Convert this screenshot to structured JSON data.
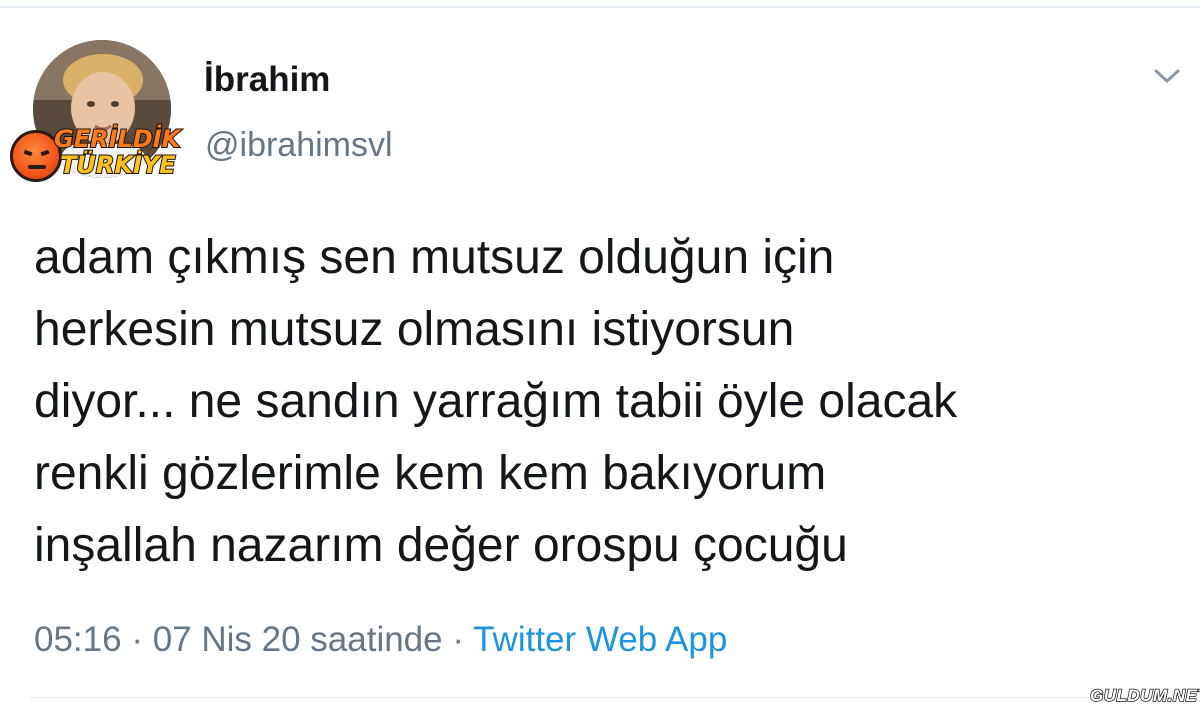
{
  "user": {
    "display_name": "İbrahim",
    "handle": "@ibrahimsvl"
  },
  "badge": {
    "line1": "GERİLDİK",
    "line2": "TÜRKİYE"
  },
  "tweet": {
    "lines": [
      "adam çıkmış sen mutsuz olduğun için",
      "herkesin mutsuz olmasını istiyorsun",
      "diyor... ne sandın yarrağım tabii öyle olacak",
      "renkli gözlerimle kem kem bakıyorum",
      "inşallah nazarım değer orospu çocuğu"
    ]
  },
  "meta": {
    "time": "05:16",
    "separator": " · ",
    "date": "07 Nis 20 saatinde",
    "source": "Twitter Web App"
  },
  "watermark": "GULDUM.NET",
  "icons": {
    "more": "chevron-down-icon"
  },
  "colors": {
    "text": "#14171a",
    "secondary": "#657786",
    "link": "#1b95e0",
    "divider": "#e6ecf0"
  }
}
